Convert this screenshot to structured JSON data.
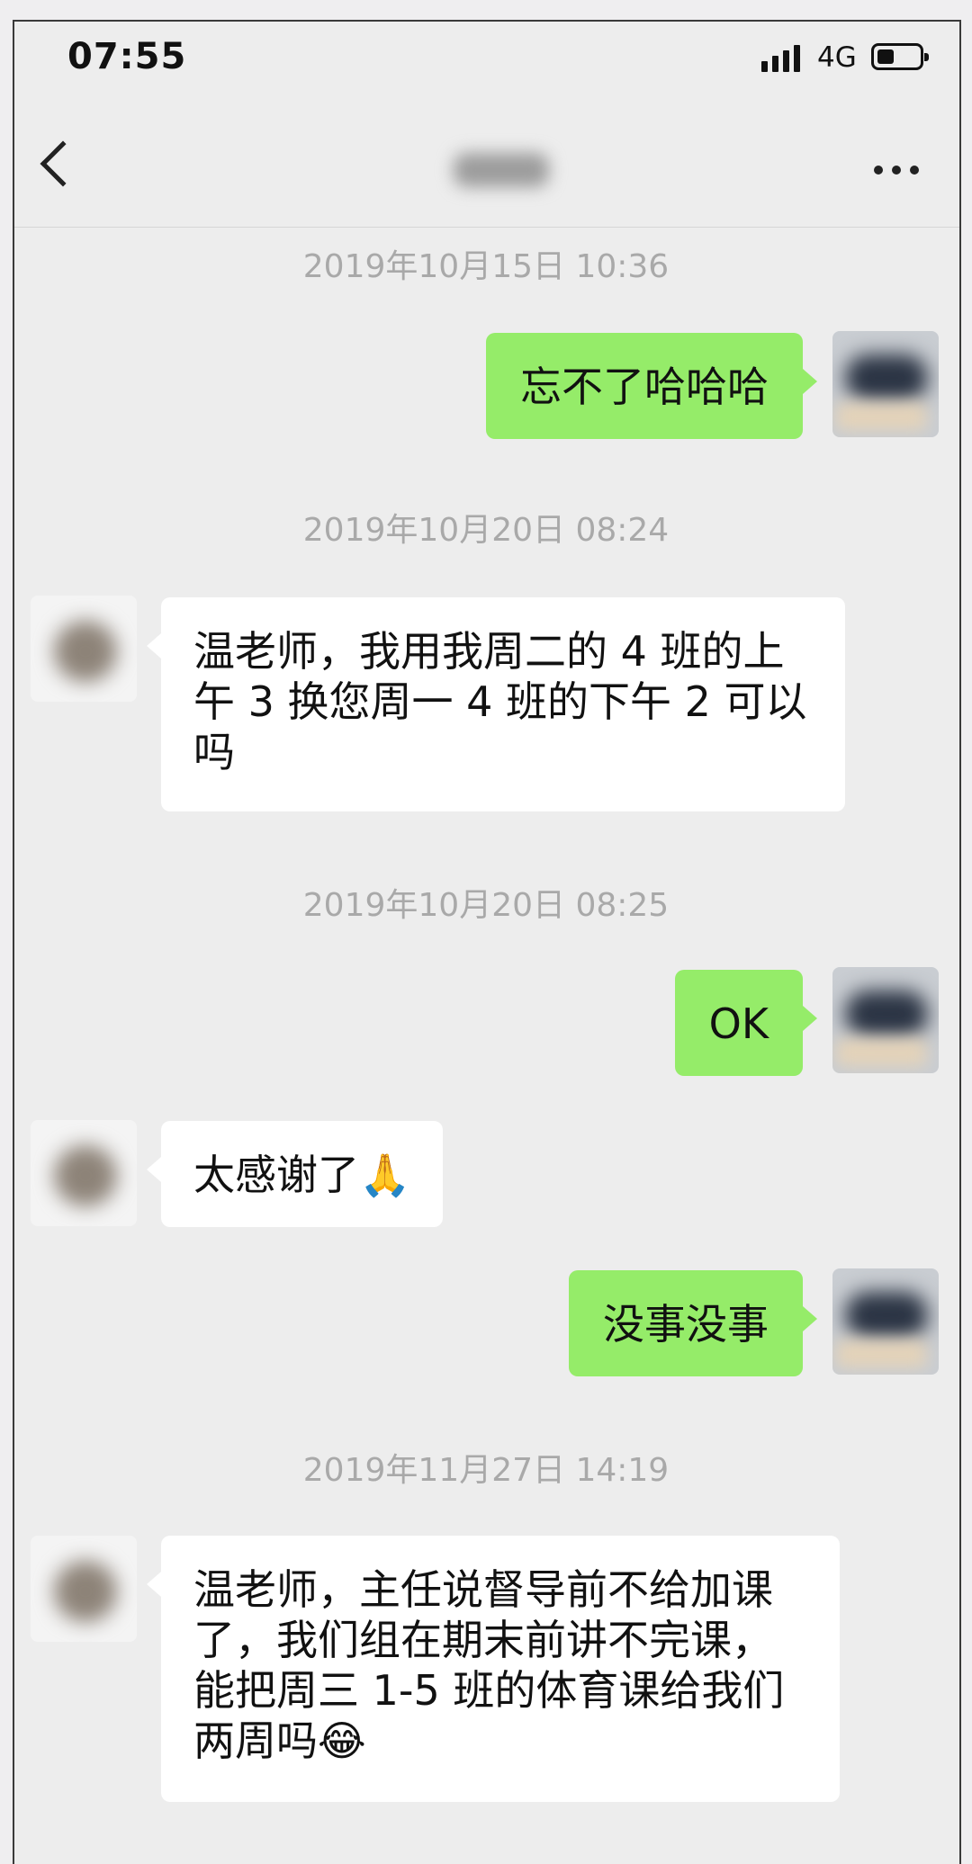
{
  "status_bar": {
    "time": "07:55",
    "network": "4G",
    "signal_icon": "signal-bars-icon",
    "battery_icon": "battery-icon"
  },
  "nav": {
    "back_icon": "chevron-left-icon",
    "more_icon": "more-dots-icon"
  },
  "messages": [
    {
      "timestamp": "2019年10月15日 10:36",
      "sender": "me",
      "text": "忘不了哈哈哈"
    },
    {
      "timestamp": "2019年10月20日 08:24",
      "sender": "other",
      "text": "温老师，我用我周二的 4 班的上午 3 换您周一 4 班的下午 2 可以吗"
    },
    {
      "timestamp": "2019年10月20日 08:25",
      "sender": "me",
      "text": "OK"
    },
    {
      "sender": "other",
      "text": "太感谢了",
      "emoji": "🙏"
    },
    {
      "sender": "me",
      "text": "没事没事"
    },
    {
      "timestamp": "2019年11月27日 14:19",
      "sender": "other",
      "text": "温老师，主任说督导前不给加课了，我们组在期末前讲不完课，能把周三 1-5 班的体育课给我们两周吗",
      "emoji": "😂"
    }
  ]
}
